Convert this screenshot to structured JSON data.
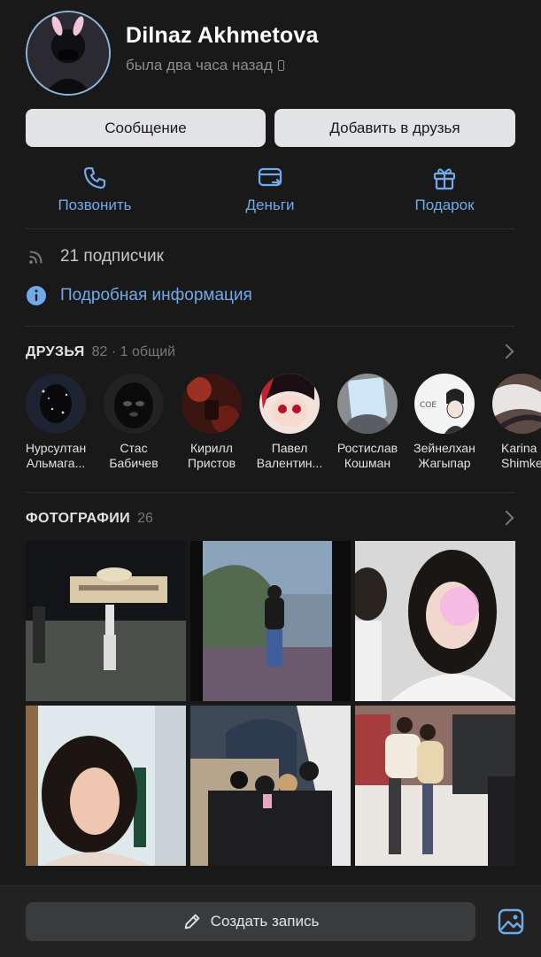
{
  "profile": {
    "name": "Dilnaz Akhmetova",
    "status": "была два часа назад",
    "status_icon": "phone-icon"
  },
  "buttons": {
    "message": "Сообщение",
    "add_friend": "Добавить в друзья"
  },
  "actions": [
    {
      "label": "Позвонить",
      "icon": "phone-call-icon"
    },
    {
      "label": "Деньги",
      "icon": "money-card-icon"
    },
    {
      "label": "Подарок",
      "icon": "gift-icon"
    }
  ],
  "followers": {
    "text": "21 подписчик",
    "icon": "rss-icon"
  },
  "details": {
    "text": "Подробная информация",
    "icon": "info-icon"
  },
  "friends": {
    "title": "ДРУЗЬЯ",
    "count": "82 · 1 общий",
    "items": [
      {
        "first": "Нурсултан",
        "last": "Альмага..."
      },
      {
        "first": "Стас",
        "last": "Бабичев"
      },
      {
        "first": "Кирилл",
        "last": "Пристов"
      },
      {
        "first": "Павел",
        "last": "Валентин..."
      },
      {
        "first": "Ростислав",
        "last": "Кошман"
      },
      {
        "first": "Зейнелхан",
        "last": "Жагыпар"
      },
      {
        "first": "Karina",
        "last": "Shimke"
      }
    ]
  },
  "photos": {
    "title": "ФОТОГРАФИИ",
    "count": "26"
  },
  "bottom": {
    "create_post": "Создать запись",
    "create_icon": "pencil-icon",
    "image_icon": "image-icon"
  },
  "colors": {
    "background": "#19191a",
    "accent": "#71aaeb",
    "button_bg": "#e1e3e6",
    "text_secondary": "#76787a"
  }
}
